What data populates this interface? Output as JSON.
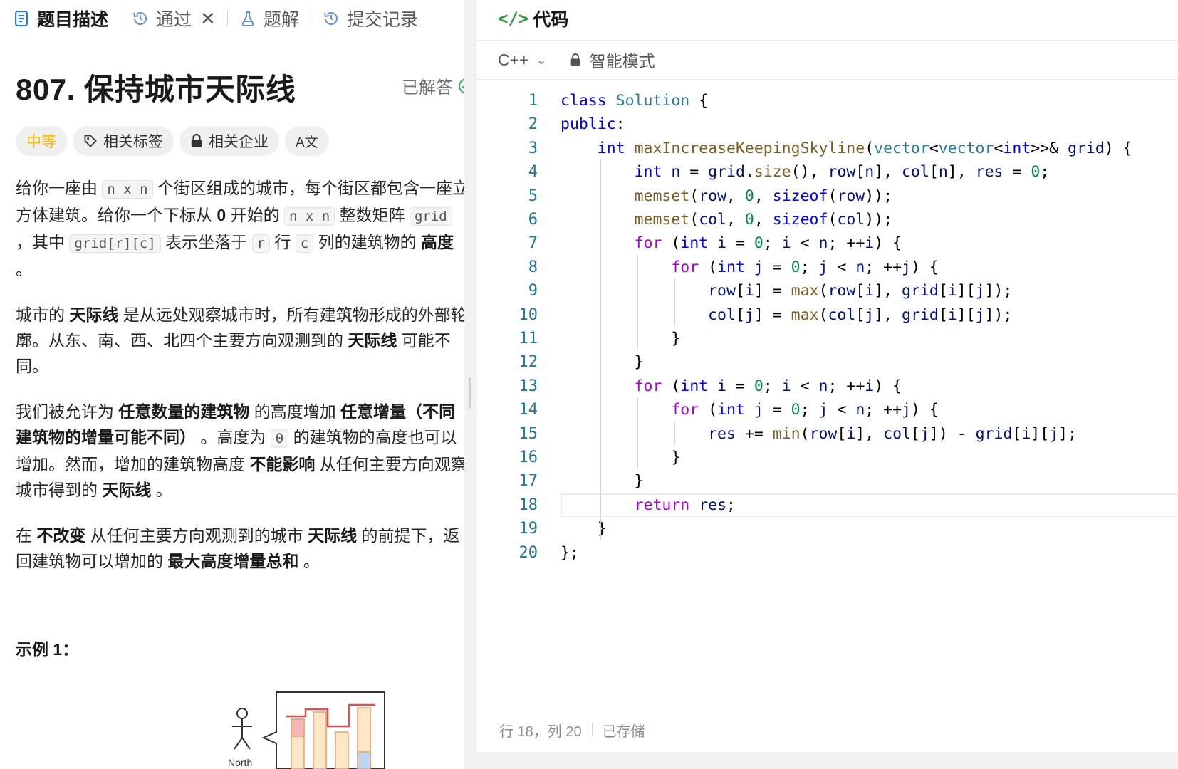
{
  "tabs": [
    {
      "label": "题目描述",
      "icon": "document-icon",
      "active": true
    },
    {
      "label": "通过",
      "icon": "history-icon",
      "closable": true
    },
    {
      "label": "题解",
      "icon": "flask-icon"
    },
    {
      "label": "提交记录",
      "icon": "history-icon"
    }
  ],
  "problem": {
    "title": "807. 保持城市天际线",
    "status": "已解答",
    "difficulty": "中等",
    "related_tags": "相关标签",
    "related_companies": "相关企业",
    "translate": "A文"
  },
  "description": {
    "p1": {
      "t1": "给你一座由 ",
      "c1": "n x n",
      "t2": " 个街区组成的城市，每个街区都包含一座立方体建筑。给你一个下标从 ",
      "b1": "0",
      "t3": " 开始的 ",
      "c2": "n x n",
      "t4": " 整数矩阵 ",
      "c3": "grid",
      "t5": " ，其中 ",
      "c4": "grid[r][c]",
      "t6": " 表示坐落于 ",
      "c5": "r",
      "t7": " 行 ",
      "c6": "c",
      "t8": " 列的建筑物的 ",
      "b2": "高度",
      "t9": " 。"
    },
    "p2": {
      "t1": "城市的 ",
      "b1": "天际线",
      "t2": " 是从远处观察城市时，所有建筑物形成的外部轮廓。从东、南、西、北四个主要方向观测到的 ",
      "b2": "天际线",
      "t3": " 可能不同。"
    },
    "p3": {
      "t1": "我们被允许为 ",
      "b1": "任意数量的建筑物",
      "t2": " 的高度增加 ",
      "b2": "任意增量（不同建筑物的增量可能不同）",
      "t3": " 。高度为 ",
      "c1": "0",
      "t4": " 的建筑物的高度也可以增加。然而，增加的建筑物高度 ",
      "b3": "不能影响",
      "t5": " 从任何主要方向观察城市得到的 ",
      "b4": "天际线",
      "t6": " 。"
    },
    "p4": {
      "t1": "在 ",
      "b1": "不改变",
      "t2": " 从任何主要方向观测到的城市 ",
      "b2": "天际线",
      "t3": " 的前提下，返回建筑物可以增加的 ",
      "b3": "最大高度增量总和",
      "t4": " 。"
    },
    "example_title": "示例 1：",
    "figure_label": "North"
  },
  "editor": {
    "title": "代码",
    "language": "C++",
    "mode": "智能模式",
    "lines": [
      "class Solution {",
      "public:",
      "    int maxIncreaseKeepingSkyline(vector<vector<int>>& grid) {",
      "        int n = grid.size(), row[n], col[n], res = 0;",
      "        memset(row, 0, sizeof(row));",
      "        memset(col, 0, sizeof(col));",
      "        for (int i = 0; i < n; ++i) {",
      "            for (int j = 0; j < n; ++j) {",
      "                row[i] = max(row[i], grid[i][j]);",
      "                col[j] = max(col[j], grid[i][j]);",
      "            }",
      "        }",
      "        for (int i = 0; i < n; ++i) {",
      "            for (int j = 0; j < n; ++j) {",
      "                res += min(row[i], col[j]) - grid[i][j];",
      "            }",
      "        }",
      "        return res;",
      "    }",
      "};"
    ],
    "current_line": 18,
    "status_position": "行 18，列 20",
    "status_saved": "已存储"
  },
  "colors": {
    "difficulty_medium": "#ffb800",
    "solved_green": "#2db55d",
    "line_number": "#237893",
    "keyword": "#0000ff",
    "control": "#af00db"
  }
}
